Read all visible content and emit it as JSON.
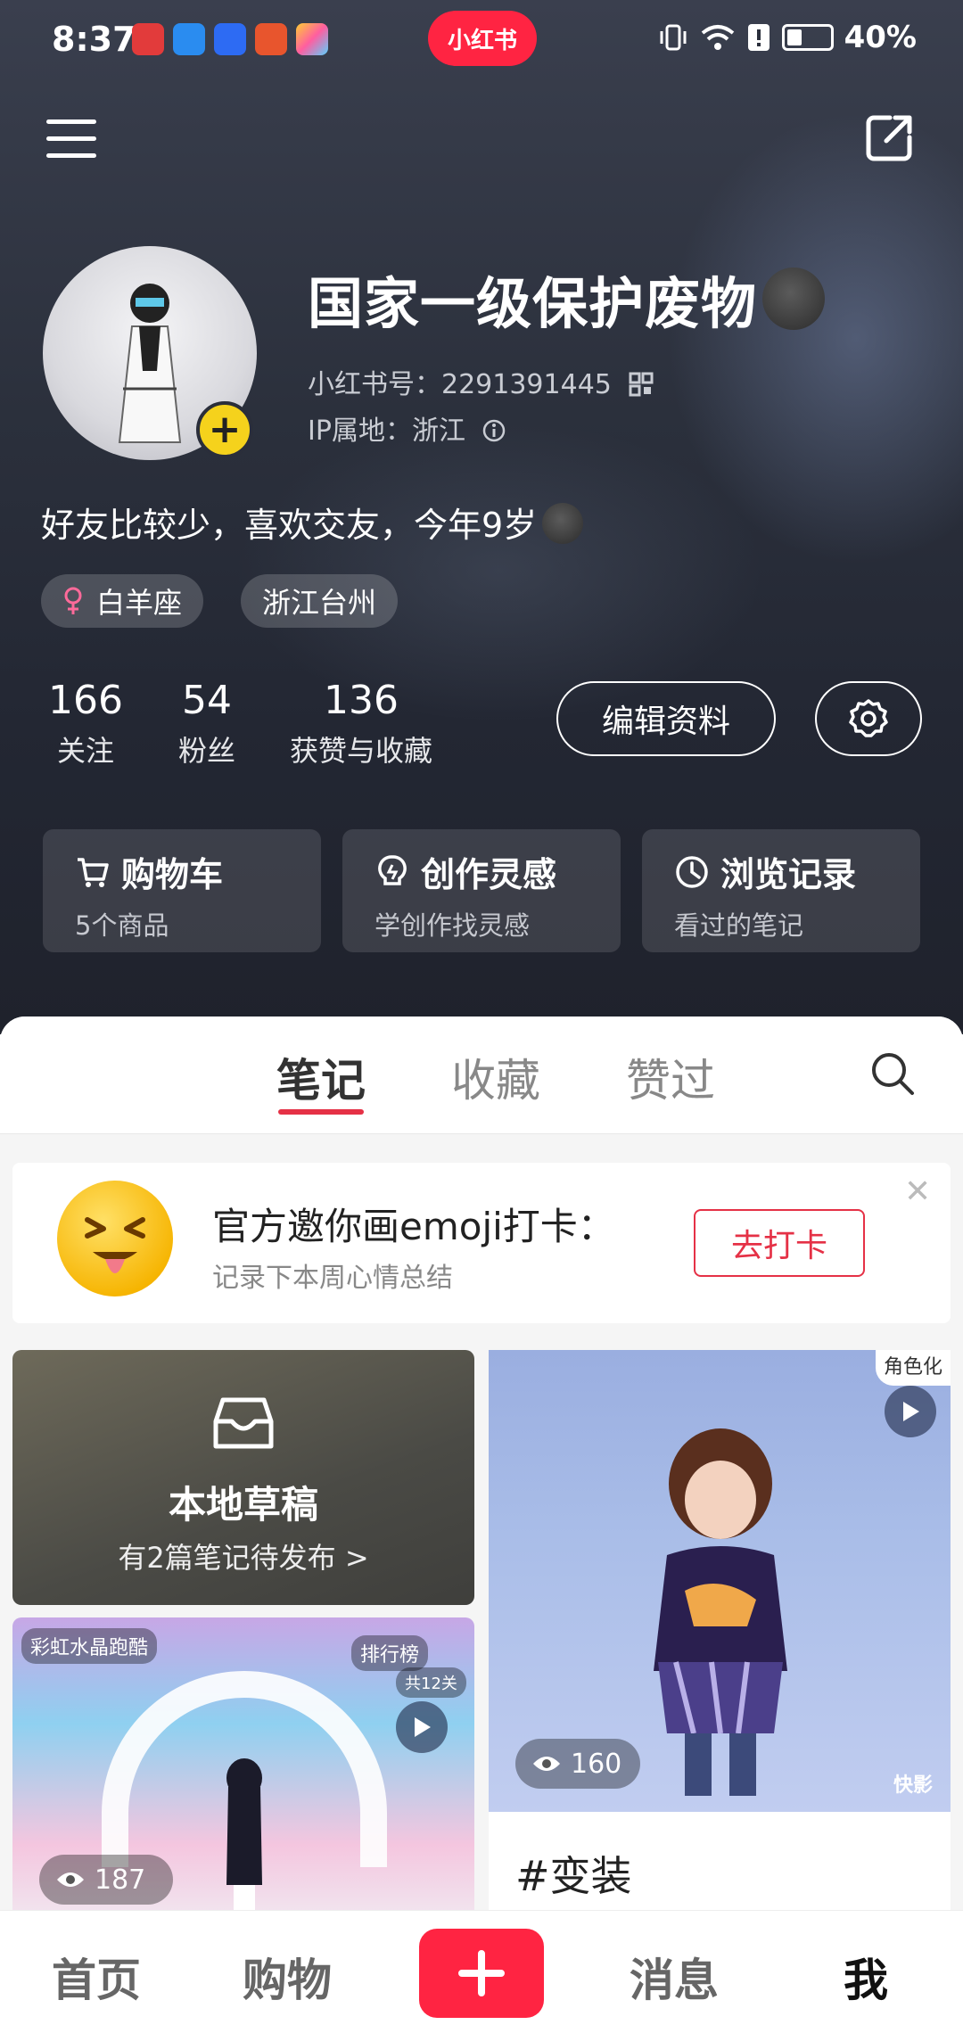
{
  "status_bar": {
    "time": "8:37",
    "center_app_label": "小红书",
    "battery": "40%"
  },
  "profile": {
    "name": "国家一级保护废物",
    "id_text": "小红书号：2291391445",
    "ip_text": "IP属地：浙江",
    "bio": "好友比较少，喜欢交友，今年9岁",
    "tags": [
      "白羊座",
      "浙江台州"
    ],
    "stats": [
      {
        "value": "166",
        "label": "关注"
      },
      {
        "value": "54",
        "label": "粉丝"
      },
      {
        "value": "136",
        "label": "获赞与收藏"
      }
    ],
    "edit_button": "编辑资料"
  },
  "shortcut_cards": [
    {
      "title": "购物车",
      "subtitle": "5个商品",
      "icon": "cart-icon"
    },
    {
      "title": "创作灵感",
      "subtitle": "学创作找灵感",
      "icon": "bulb-icon"
    },
    {
      "title": "浏览记录",
      "subtitle": "看过的笔记",
      "icon": "clock-icon"
    }
  ],
  "tabs": [
    "笔记",
    "收藏",
    "赞过"
  ],
  "active_tab": "笔记",
  "banner": {
    "title": "官方邀你画emoji打卡：",
    "subtitle": "记录下本周心情总结",
    "button": "去打卡"
  },
  "draft": {
    "title": "本地草稿",
    "subtitle": "有2篇笔记待发布 >"
  },
  "notes": [
    {
      "views": "187",
      "chips": [
        "彩虹水晶跑酷",
        "排行榜",
        "共12关"
      ]
    },
    {
      "views": "160",
      "caption": "#变装",
      "corner_label": "角色化",
      "watermark": "快影"
    }
  ],
  "bottom_nav": [
    "首页",
    "购物",
    "消息",
    "我"
  ],
  "active_nav": "我",
  "colors": {
    "accent": "#ff2442",
    "tab_underline": "#e53146",
    "avatar_badge": "#f5d21c"
  }
}
